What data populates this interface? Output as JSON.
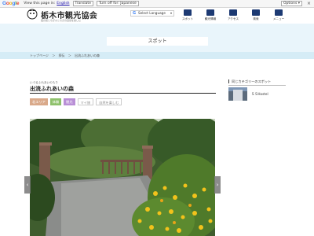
{
  "translate_bar": {
    "view_text": "View this page in:",
    "lang_link": "English",
    "translate_btn": "Translate",
    "turn_off_btn": "Turn off for: Japanese",
    "options_btn": "Options ▾",
    "close": "×"
  },
  "header": {
    "site_title": "栃木市観光協会",
    "site_sub": "蔵の街とちぎ＆とちぎの自然を楽しむ",
    "lang_select": "Select Language",
    "nav": [
      {
        "label": "スポット"
      },
      {
        "label": "観光情報"
      },
      {
        "label": "アクセス"
      },
      {
        "label": "検索"
      },
      {
        "label": "メニュー"
      }
    ]
  },
  "hero": {
    "title": "スポット"
  },
  "breadcrumb": [
    "トップページ",
    "＞",
    "探伝",
    "＞",
    "出流ふれあいの森"
  ],
  "article": {
    "kana": "いづるふれあいのもり",
    "title": "出流ふれあいの森",
    "tags": [
      "北エリア",
      "体験",
      "観光",
      "マイ旅",
      "自然を楽しむ"
    ]
  },
  "slider": {
    "prev": "‹",
    "next": "›"
  },
  "sidebar": {
    "heading": "同じカテゴリーのスポット",
    "items": [
      {
        "label": "ＳＳHostel"
      }
    ]
  },
  "colors": {
    "hero_bg": "#e9f5fb",
    "breadcrumb_bg": "#d5ecf6",
    "nav_icon": "#1d3a73"
  }
}
